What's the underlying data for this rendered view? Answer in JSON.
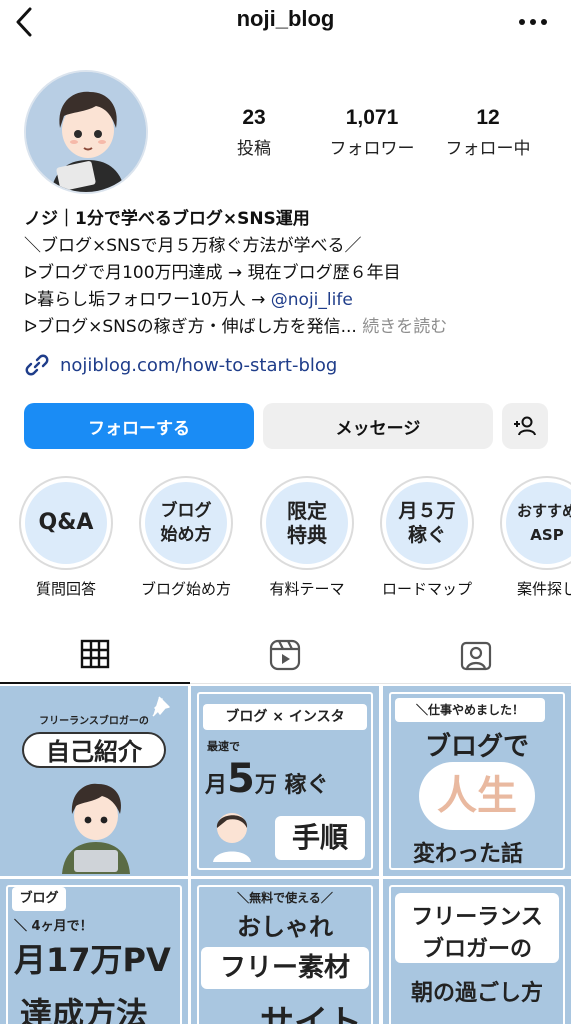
{
  "topbar": {
    "username": "noji_blog"
  },
  "stats": [
    {
      "count": "23",
      "label": "投稿"
    },
    {
      "count": "1,071",
      "label": "フォロワー"
    },
    {
      "count": "12",
      "label": "フォロー中"
    }
  ],
  "bio": {
    "name": "ノジ｜1分で学べるブログ×SNS運用",
    "line1": "＼ブログ×SNSで月５万稼ぐ方法が学べる／",
    "line2": "ᐅブログで月100万円達成 → 現在ブログ歴６年目",
    "line3_prefix": "ᐅ暮らし垢フォロワー10万人 → ",
    "line3_mention": "@noji_life",
    "line4": "ᐅブログ×SNSの稼ぎ方・伸ばし方を発信...",
    "more": " 続きを読む",
    "link": "nojiblog.com/how-to-start-blog"
  },
  "buttons": {
    "follow": "フォローする",
    "message": "メッセージ"
  },
  "highlights": [
    {
      "cover": "Q&A",
      "label": "質問回答"
    },
    {
      "cover": "ブログ\n始め方",
      "label": "ブログ始め方"
    },
    {
      "cover": "限定\n特典",
      "label": "有料テーマ"
    },
    {
      "cover": "月５万\n稼ぐ",
      "label": "ロードマップ"
    },
    {
      "cover": "おすすめ\nASP",
      "label": "案件探し"
    }
  ],
  "posts": [
    {
      "top": "フリーランスブロガーの",
      "main": "自己紹介"
    },
    {
      "top": "ブログ × インスタ",
      "sub": "最速で",
      "main1": "月",
      "main2": "5",
      "main3": "万 稼ぐ",
      "bottom": "手順"
    },
    {
      "top": "＼仕事やめました！",
      "main": "ブログで",
      "big": "人生",
      "bottom": "変わった話"
    },
    {
      "top": "ブログ",
      "sub": "＼ 4ヶ月で！",
      "main": "月17万PV",
      "bottom": "達成方法"
    },
    {
      "top": "＼無料で使える／",
      "main": "おしゃれ",
      "main2": "フリー素材",
      "bottom": "サイト"
    },
    {
      "top": "フリーランス",
      "main": "ブロガーの",
      "bottom": "朝の過ごし方"
    }
  ],
  "colors": {
    "accent": "#1a8cf5",
    "post_bg": "#a9c6e0",
    "link": "#1f3d8a"
  }
}
